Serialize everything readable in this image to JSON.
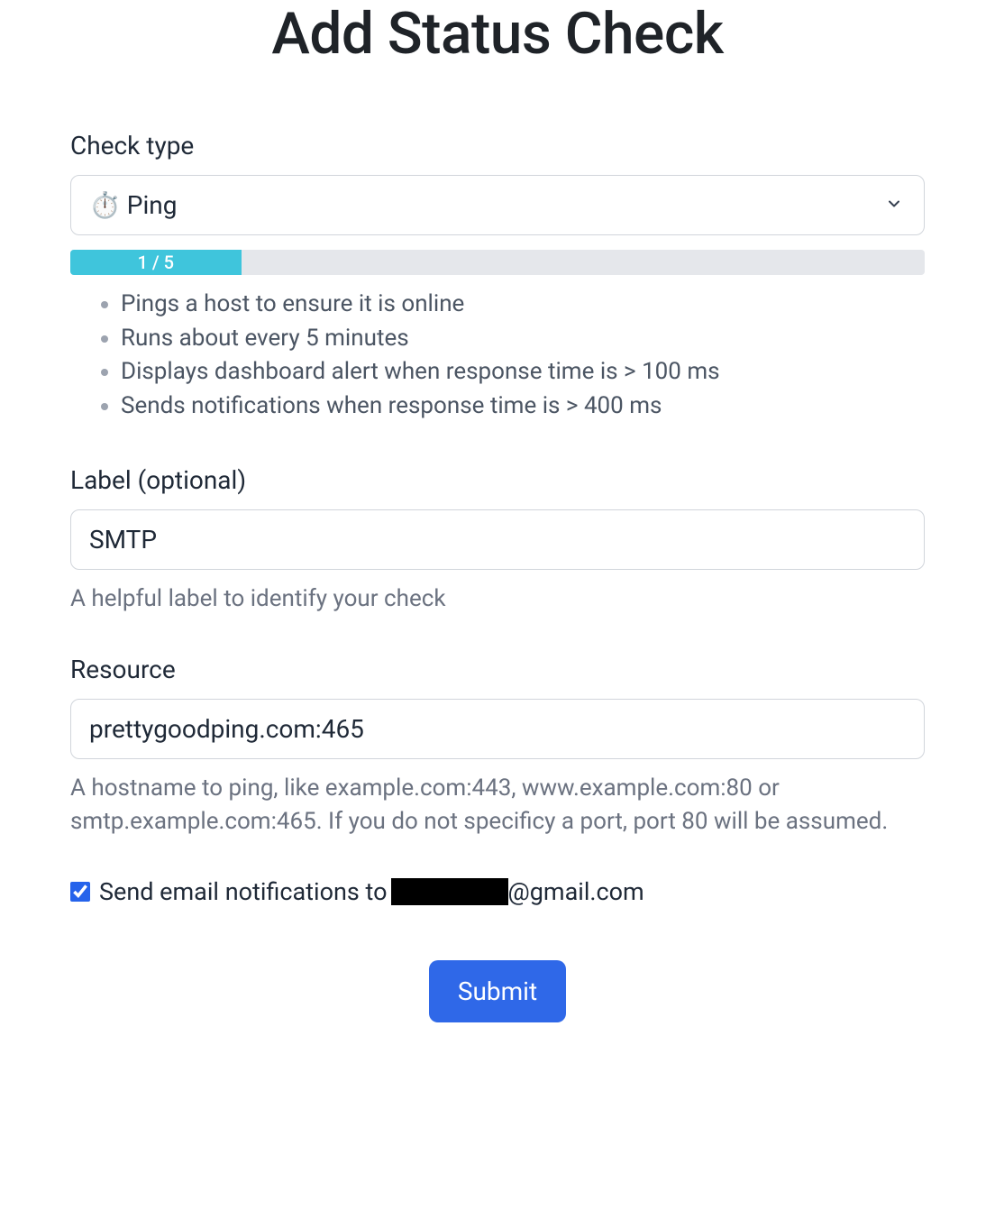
{
  "title": "Add Status Check",
  "check_type": {
    "label": "Check type",
    "selected": "⏱️ Ping",
    "progress_text": "1 / 5",
    "progress_percent": 20,
    "description_items": [
      "Pings a host to ensure it is online",
      "Runs about every 5 minutes",
      "Displays dashboard alert when response time is > 100 ms",
      "Sends notifications when response time is > 400 ms"
    ]
  },
  "label_field": {
    "label": "Label (optional)",
    "value": "SMTP",
    "help": "A helpful label to identify your check"
  },
  "resource_field": {
    "label": "Resource",
    "value": "prettygoodping.com:465",
    "help": "A hostname to ping, like example.com:443, www.example.com:80 or smtp.example.com:465. If you do not specificy a port, port 80 will be assumed."
  },
  "notifications": {
    "checked": true,
    "label_prefix": "Send email notifications to ",
    "email_suffix": "@gmail.com"
  },
  "submit_label": "Submit"
}
